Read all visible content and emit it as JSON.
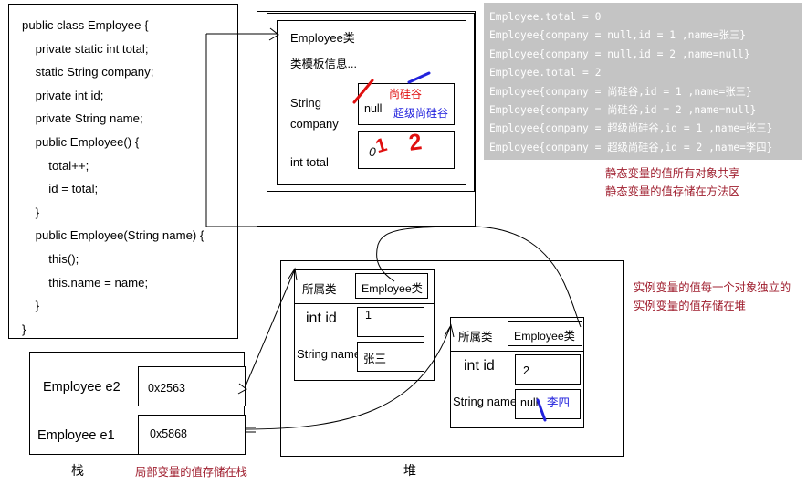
{
  "code_panel": {
    "lines": [
      "public class Employee {",
      "    private static int total;",
      "    static String company;",
      "    private int id;",
      "    private String name;",
      "    public Employee() {",
      "        total++;",
      "        id = total;",
      "    }",
      "    public Employee(String name) {",
      "        this();",
      "        this.name = name;",
      "    }",
      "}"
    ]
  },
  "method_area": {
    "class_title": "Employee类",
    "class_subtitle": "类模板信息...",
    "static_field_1": {
      "label_line1": "String",
      "label_line2": "company"
    },
    "static_field_2": {
      "label": "int total"
    },
    "company_values": {
      "old": "null",
      "mid": "尚硅谷",
      "current": "超级尚硅谷"
    },
    "total_values": {
      "old": "0",
      "mid": "1",
      "current": "2"
    }
  },
  "console": {
    "lines": [
      "Employee.total = 0",
      "Employee{company = null,id = 1 ,name=张三}",
      "Employee{company = null,id = 2 ,name=null}",
      "Employee.total = 2",
      "Employee{company = 尚硅谷,id = 1 ,name=张三}",
      "Employee{company = 尚硅谷,id = 2 ,name=null}",
      "Employee{company = 超级尚硅谷,id = 1 ,name=张三}",
      "Employee{company = 超级尚硅谷,id = 2 ,name=李四}"
    ]
  },
  "notes": {
    "static_note_1": "静态变量的值所有对象共享",
    "static_note_2": "静态变量的值存储在方法区",
    "instance_note_1": "实例变量的值每一个对象独立的",
    "instance_note_2": "实例变量的值存储在堆",
    "stack_note": "局部变量的值存储在栈"
  },
  "heap": {
    "area_label": "堆",
    "objects": [
      {
        "class_row_label": "所属类",
        "class_row_value": "Employee类",
        "id_label": "int id",
        "id_value": "1",
        "name_label": "String name",
        "name_value": "张三",
        "name_old_value": ""
      },
      {
        "class_row_label": "所属类",
        "class_row_value": "Employee类",
        "id_label": "int id",
        "id_value": "2",
        "name_label": "String name",
        "name_value": "李四",
        "name_old_value": "null"
      }
    ]
  },
  "stack": {
    "area_label": "栈",
    "slots": [
      {
        "label": "Employee e2",
        "address": "0x2563"
      },
      {
        "label": "Employee e1",
        "address": "0x5868"
      }
    ]
  },
  "colors": {
    "red": "#e01010",
    "blue": "#2222dd",
    "note_red": "#a02030",
    "console_bg": "#c4c4c4",
    "console_text": "#ffffff",
    "ink": "#000000"
  }
}
